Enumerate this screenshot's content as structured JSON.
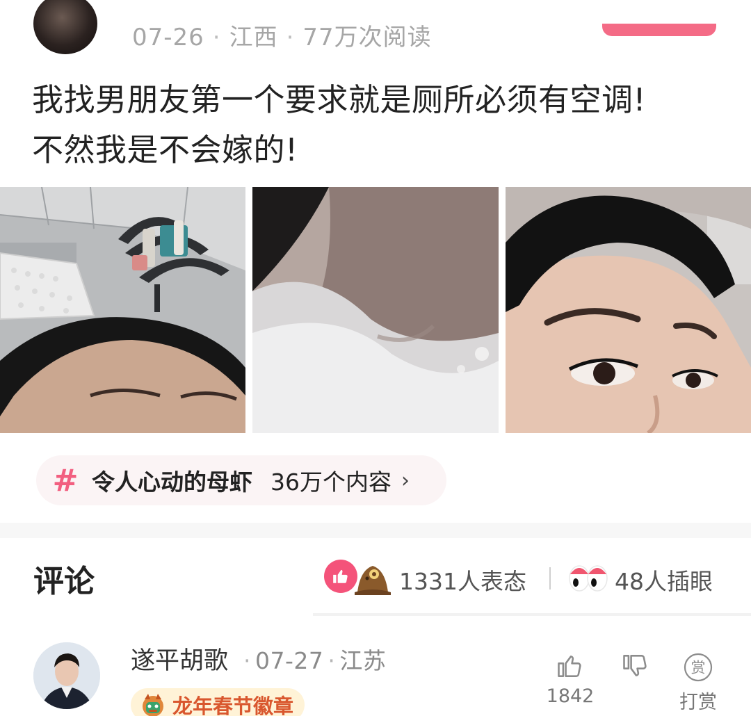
{
  "post": {
    "date": "07-26",
    "location": "江西",
    "reads": "77万次阅读",
    "text_line_1": "我找男朋友第一个要求就是厕所必须有空调!",
    "text_line_2": "不然我是不会嫁的!"
  },
  "topic": {
    "hash": "#",
    "name": "令人心动的母虾",
    "count": "36万个内容",
    "chevron": "›"
  },
  "comments": {
    "title": "评论",
    "reactions_count": "1331人表态",
    "eyes_count": "48人插眼",
    "items": [
      {
        "author": "遂平胡歌",
        "date": "07-27",
        "location": "江苏",
        "badge": "龙年春节徽章",
        "likes": "1842",
        "tip_label": "打赏",
        "tip_icon_char": "赏"
      }
    ]
  },
  "colors": {
    "accent_pink": "#f25f80",
    "badge_text": "#d9572e"
  }
}
